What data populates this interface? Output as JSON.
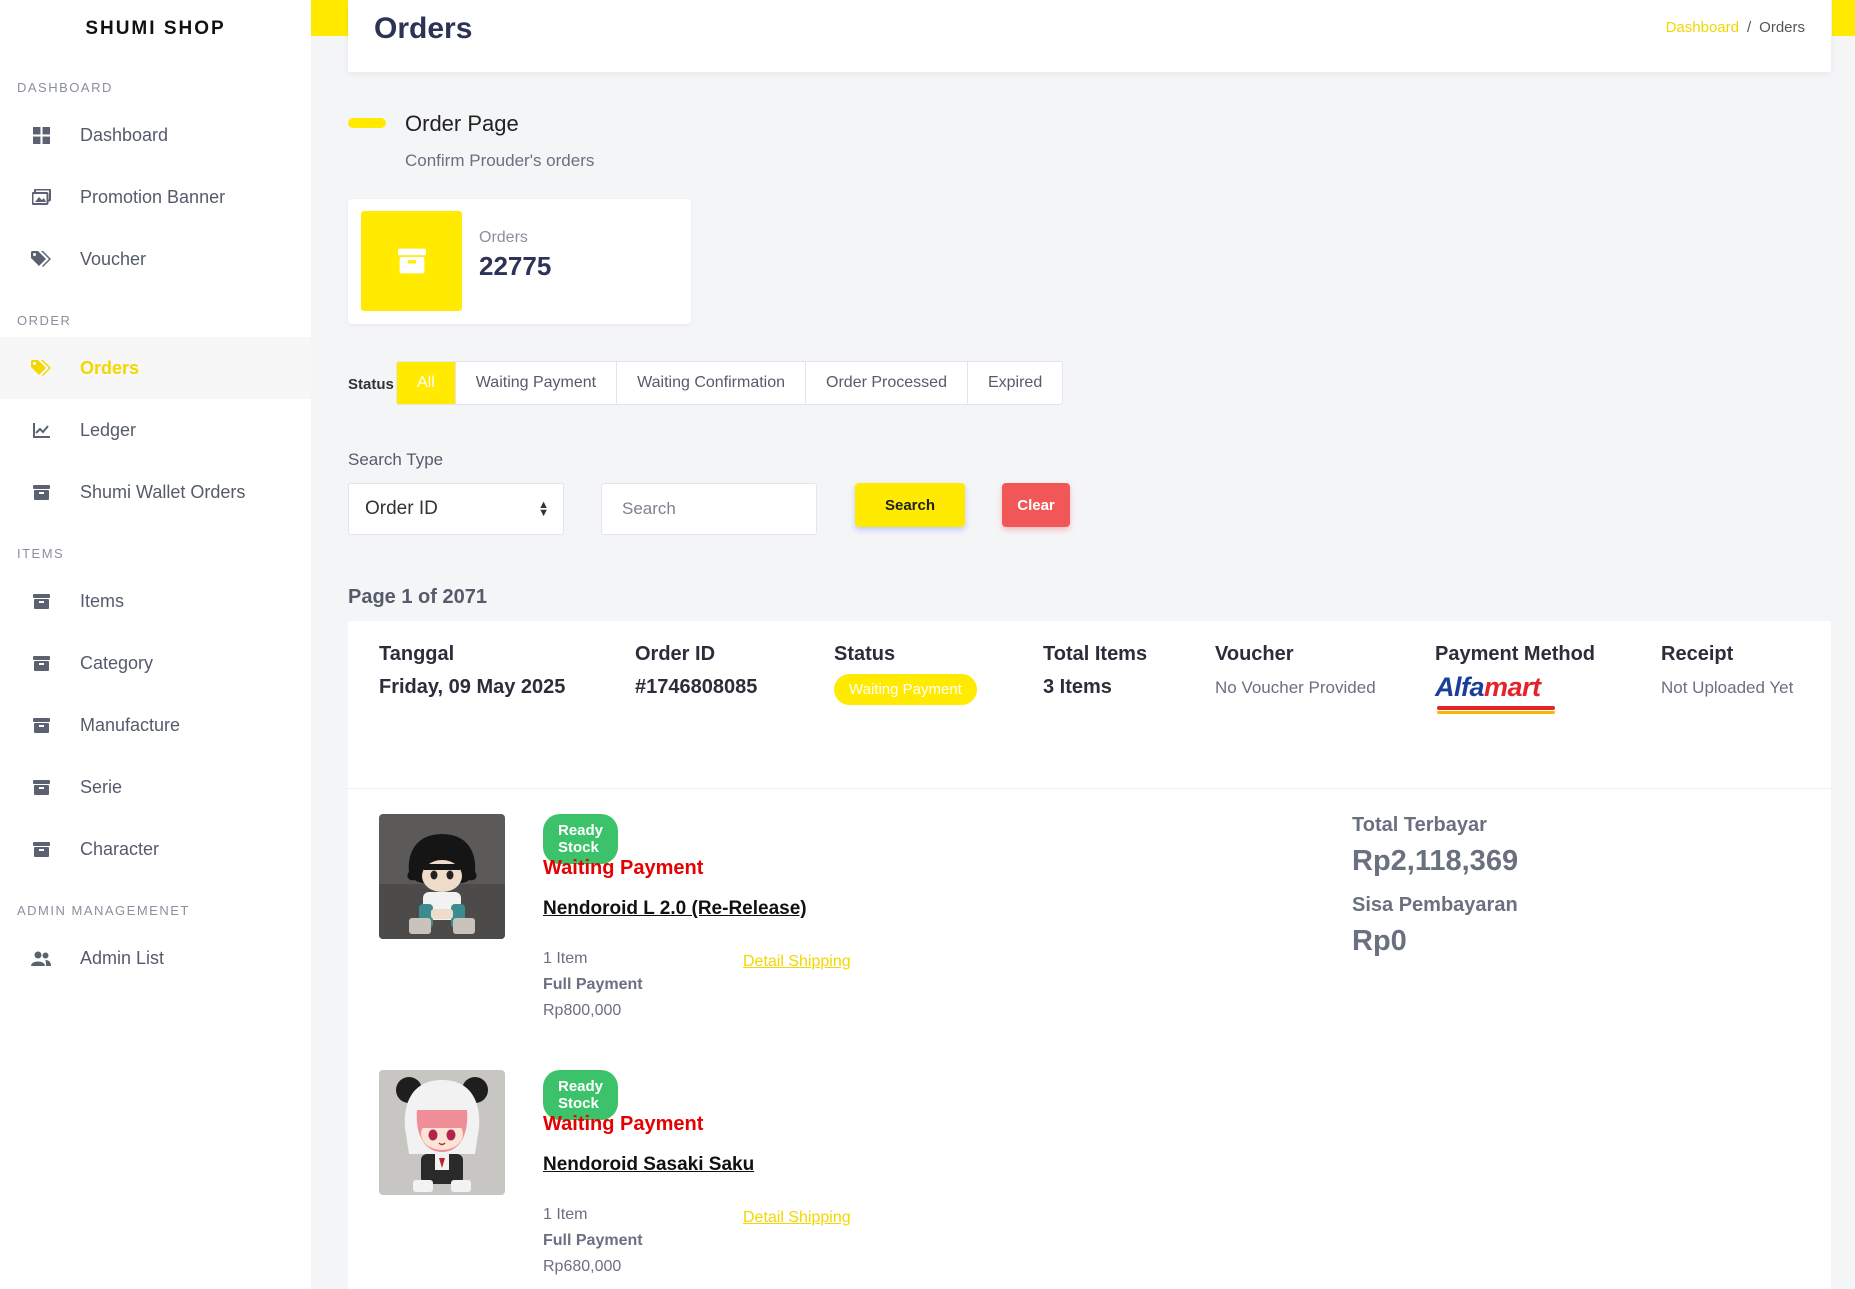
{
  "brand": "SHUMI SHOP",
  "sidebar": {
    "sections": [
      {
        "title": "DASHBOARD",
        "items": [
          {
            "label": "Dashboard",
            "icon": "grid-icon"
          },
          {
            "label": "Promotion Banner",
            "icon": "images-icon"
          },
          {
            "label": "Voucher",
            "icon": "tags-icon"
          }
        ]
      },
      {
        "title": "ORDER",
        "items": [
          {
            "label": "Orders",
            "icon": "tags-icon",
            "active": true
          },
          {
            "label": "Ledger",
            "icon": "chart-line-icon"
          },
          {
            "label": "Shumi Wallet Orders",
            "icon": "wallet-icon"
          }
        ]
      },
      {
        "title": "ITEMS",
        "items": [
          {
            "label": "Items",
            "icon": "archive-icon"
          },
          {
            "label": "Category",
            "icon": "archive-icon"
          },
          {
            "label": "Manufacture",
            "icon": "archive-icon"
          },
          {
            "label": "Serie",
            "icon": "archive-icon"
          },
          {
            "label": "Character",
            "icon": "archive-icon"
          }
        ]
      },
      {
        "title": "ADMIN MANAGEMENET",
        "items": [
          {
            "label": "Admin List",
            "icon": "users-icon"
          }
        ]
      }
    ]
  },
  "header": {
    "title": "Orders",
    "breadcrumb": [
      "Dashboard",
      "Orders"
    ],
    "breadcrumb_sep": "/"
  },
  "page": {
    "title": "Order Page",
    "subtitle": "Confirm Prouder's orders"
  },
  "stat": {
    "label": "Orders",
    "value": "22775",
    "icon": "archive-icon"
  },
  "status_filter": {
    "label": "Status",
    "tabs": [
      "All",
      "Waiting Payment",
      "Waiting Confirmation",
      "Order Processed",
      "Expired"
    ],
    "active": "All"
  },
  "search": {
    "type_label": "Search Type",
    "type_value": "Order ID",
    "placeholder": "Search",
    "search_button": "Search",
    "clear_button": "Clear"
  },
  "pagination": {
    "text": "Page 1 of 2071"
  },
  "order": {
    "headers": {
      "date": "Tanggal",
      "order_id": "Order ID",
      "status": "Status",
      "total_items": "Total Items",
      "voucher": "Voucher",
      "payment_method": "Payment Method",
      "receipt": "Receipt"
    },
    "date": "Friday, 09 May 2025",
    "order_id": "#1746808085",
    "status": "Waiting Payment",
    "total_items": "3 Items",
    "voucher": "No Voucher Provided",
    "payment_logo": {
      "part1": "Alfa",
      "part2": "mart"
    },
    "receipt": "Not Uploaded Yet",
    "items": [
      {
        "stock": "Ready Stock",
        "status": "Waiting Payment",
        "name": "Nendoroid L 2.0 (Re-Release)",
        "qty": "1 Item",
        "payment": "Full Payment",
        "price": "Rp800,000",
        "shipping_link": "Detail Shipping"
      },
      {
        "stock": "Ready Stock",
        "status": "Waiting Payment",
        "name": "Nendoroid Sasaki Saku",
        "qty": "1 Item",
        "payment": "Full Payment",
        "price": "Rp680,000",
        "shipping_link": "Detail Shipping"
      }
    ],
    "totals": {
      "paid_label": "Total Terbayar",
      "paid_value": "Rp2,118,369",
      "remaining_label": "Sisa Pembayaran",
      "remaining_value": "Rp0"
    }
  },
  "colors": {
    "accent": "#ffea00",
    "danger": "#f25757",
    "success": "#3cc26a",
    "status_red": "#e60000"
  }
}
